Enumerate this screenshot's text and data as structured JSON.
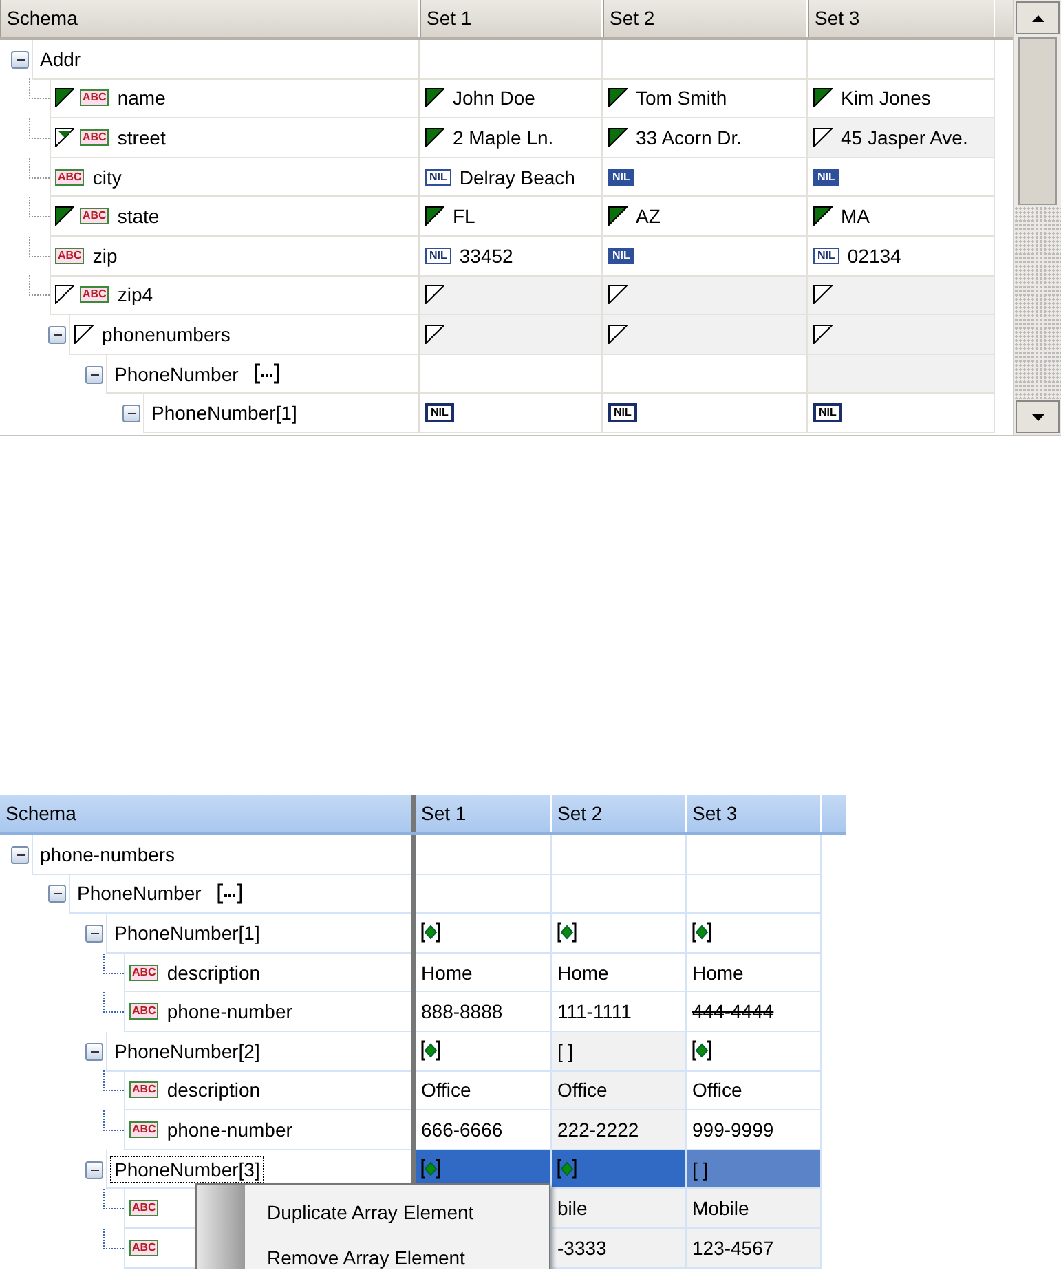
{
  "top_grid": {
    "columns": [
      "Schema",
      "Set 1",
      "Set 2",
      "Set 3"
    ],
    "rows": [
      {
        "label": "Addr",
        "expanded": true,
        "cells": [
          {},
          {},
          {}
        ],
        "children": [
          {
            "label": "name",
            "flag": {
              "kind": "filled"
            },
            "type_label": "ABC",
            "cells": [
              {
                "flag": {
                  "kind": "filled"
                },
                "text": "John Doe"
              },
              {
                "flag": {
                  "kind": "filled"
                },
                "text": "Tom Smith"
              },
              {
                "flag": {
                  "kind": "filled"
                },
                "text": "Kim Jones"
              }
            ]
          },
          {
            "label": "street",
            "flag": {
              "kind": "partial"
            },
            "type_label": "ABC",
            "cells": [
              {
                "flag": {
                  "kind": "filled"
                },
                "text": "2 Maple Ln."
              },
              {
                "flag": {
                  "kind": "filled"
                },
                "text": "33 Acorn Dr."
              },
              {
                "flag": {
                  "kind": "empty"
                },
                "text": "45 Jasper Ave.",
                "shaded": true
              }
            ]
          },
          {
            "label": "city",
            "type_label": "ABC",
            "cells": [
              {
                "nil": {
                  "label": "NIL",
                  "kind": "outline"
                },
                "text": "Delray Beach"
              },
              {
                "nil": {
                  "label": "NIL",
                  "kind": "solid"
                }
              },
              {
                "nil": {
                  "label": "NIL",
                  "kind": "solid"
                }
              }
            ]
          },
          {
            "label": "state",
            "flag": {
              "kind": "filled"
            },
            "type_label": "ABC",
            "cells": [
              {
                "flag": {
                  "kind": "filled"
                },
                "text": "FL"
              },
              {
                "flag": {
                  "kind": "filled"
                },
                "text": "AZ"
              },
              {
                "flag": {
                  "kind": "filled"
                },
                "text": "MA"
              }
            ]
          },
          {
            "label": "zip",
            "type_label": "ABC",
            "cells": [
              {
                "nil": {
                  "label": "NIL",
                  "kind": "outline"
                },
                "text": "33452"
              },
              {
                "nil": {
                  "label": "NIL",
                  "kind": "solid"
                }
              },
              {
                "nil": {
                  "label": "NIL",
                  "kind": "outline"
                },
                "text": "02134"
              }
            ]
          },
          {
            "label": "zip4",
            "flag": {
              "kind": "empty"
            },
            "type_label": "ABC",
            "cells": [
              {
                "flag": {
                  "kind": "empty"
                },
                "shaded": true
              },
              {
                "flag": {
                  "kind": "empty"
                },
                "shaded": true
              },
              {
                "flag": {
                  "kind": "empty"
                },
                "shaded": true
              }
            ]
          },
          {
            "label": "phonenumbers",
            "flag": {
              "kind": "empty"
            },
            "expanded": true,
            "cells": [
              {
                "flag": {
                  "kind": "empty"
                },
                "shaded": true
              },
              {
                "flag": {
                  "kind": "empty"
                },
                "shaded": true
              },
              {
                "flag": {
                  "kind": "empty"
                },
                "shaded": true
              }
            ],
            "children": [
              {
                "label": "PhoneNumber",
                "array": true,
                "expanded": true,
                "cells": [
                  {},
                  {},
                  {
                    "shaded": true
                  }
                ],
                "children": [
                  {
                    "label": "PhoneNumber[1]",
                    "expanded": true,
                    "cells": [
                      {
                        "nil": {
                          "label": "NIL",
                          "kind": "bold"
                        }
                      },
                      {
                        "nil": {
                          "label": "NIL",
                          "kind": "bold"
                        }
                      },
                      {
                        "nil": {
                          "label": "NIL",
                          "kind": "bold"
                        }
                      }
                    ]
                  }
                ]
              }
            ]
          }
        ]
      }
    ]
  },
  "bottom_grid": {
    "columns": [
      "Schema",
      "Set 1",
      "Set 2",
      "Set 3"
    ],
    "rows": [
      {
        "label": "phone-numbers",
        "expanded": true,
        "selected": false,
        "cells": [
          {},
          {},
          {}
        ],
        "children": [
          {
            "label": "PhoneNumber",
            "array": true,
            "expanded": true,
            "selected": false,
            "cells": [
              {},
              {},
              {}
            ],
            "children": [
              {
                "label": "PhoneNumber[1]",
                "expanded": true,
                "selected": false,
                "cells": [
                  {
                    "marker": {
                      "kind": "present"
                    }
                  },
                  {
                    "marker": {
                      "kind": "present"
                    }
                  },
                  {
                    "marker": {
                      "kind": "present"
                    }
                  }
                ],
                "children": [
                  {
                    "label": "description",
                    "type_label": "ABC",
                    "selected": false,
                    "cells": [
                      {
                        "text": "Home"
                      },
                      {
                        "text": "Home"
                      },
                      {
                        "text": "Home"
                      }
                    ]
                  },
                  {
                    "label": "phone-number",
                    "type_label": "ABC",
                    "selected": false,
                    "cells": [
                      {
                        "text": "888-8888"
                      },
                      {
                        "text": "111-1111"
                      },
                      {
                        "text": "444-4444",
                        "struck": true
                      }
                    ]
                  }
                ]
              },
              {
                "label": "PhoneNumber[2]",
                "expanded": true,
                "selected": false,
                "cells": [
                  {
                    "marker": {
                      "kind": "present"
                    }
                  },
                  {
                    "text": "[ ]",
                    "shaded": true
                  },
                  {
                    "marker": {
                      "kind": "present"
                    }
                  }
                ],
                "children": [
                  {
                    "label": "description",
                    "type_label": "ABC",
                    "selected": false,
                    "cells": [
                      {
                        "text": "Office"
                      },
                      {
                        "text": "Office",
                        "shaded": true
                      },
                      {
                        "text": "Office"
                      }
                    ]
                  },
                  {
                    "label": "phone-number",
                    "type_label": "ABC",
                    "selected": false,
                    "cells": [
                      {
                        "text": "666-6666"
                      },
                      {
                        "text": "222-2222",
                        "shaded": true
                      },
                      {
                        "text": "999-9999"
                      }
                    ]
                  }
                ]
              },
              {
                "label": "PhoneNumber[3]",
                "expanded": true,
                "selected": true,
                "cells": [
                  {
                    "marker": {
                      "kind": "present"
                    }
                  },
                  {
                    "marker": {
                      "kind": "present"
                    }
                  },
                  {
                    "text": "[ ]"
                  }
                ],
                "children": [
                  {
                    "type_label": "ABC",
                    "selected": false,
                    "cells": [
                      {},
                      {
                        "text": "bile",
                        "shaded": true
                      },
                      {
                        "text": "Mobile",
                        "shaded": true
                      }
                    ]
                  },
                  {
                    "type_label": "ABC",
                    "selected": false,
                    "cells": [
                      {},
                      {
                        "text": "-3333",
                        "shaded": true
                      },
                      {
                        "text": "123-4567",
                        "shaded": true
                      }
                    ]
                  }
                ]
              }
            ]
          }
        ]
      }
    ]
  },
  "context_menu": {
    "items": [
      "Duplicate Array Element",
      "Remove Array Element"
    ]
  }
}
